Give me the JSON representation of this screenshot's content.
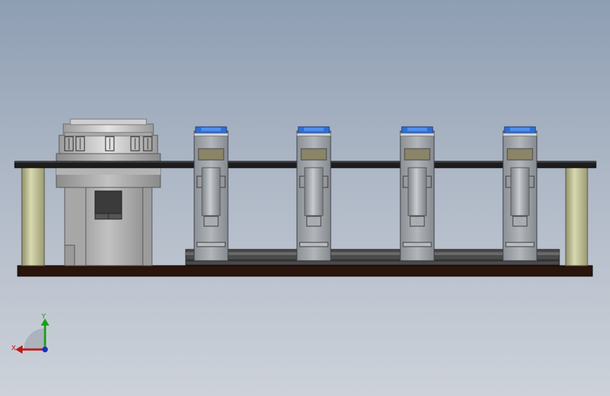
{
  "scene": {
    "background_top": "#8e9eb3",
    "background_bottom": "#cdd2da",
    "view": "front"
  },
  "model": {
    "module_count": 4,
    "colors": {
      "base_plate": "#2a140c",
      "top_plate": "#1d1d1d",
      "standoff": "#c8c89a",
      "module_body": "#9aa0a6",
      "module_cap": "#2f6fd6",
      "label_window": "#8a8468",
      "rail": "#4a4a4a"
    }
  },
  "triad": {
    "x_label": "X",
    "y_label": "Y",
    "x_color": "#c01818",
    "y_color": "#18a018",
    "z_color": "#1830c0"
  }
}
